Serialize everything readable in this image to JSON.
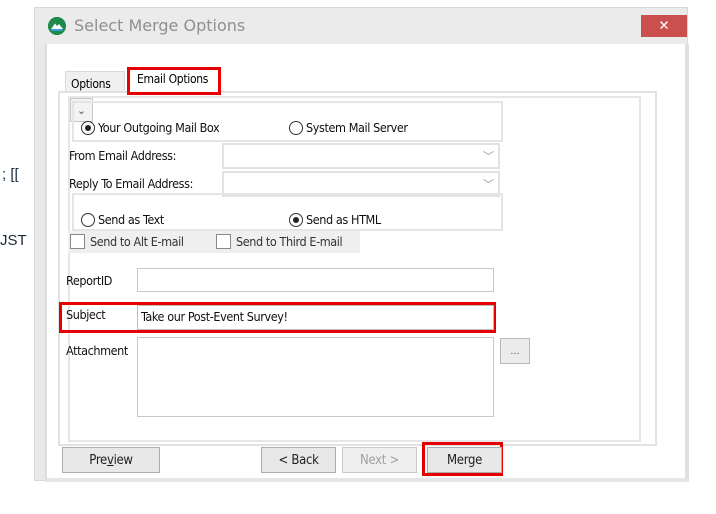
{
  "background": {
    "fragment1": "; [[",
    "fragment2": "JST"
  },
  "window": {
    "title": "Select Merge Options",
    "app_icon": "mountain-logo-icon",
    "close_icon": "close-icon",
    "close_label": "✕"
  },
  "tabs": [
    {
      "label": "Options",
      "active": false
    },
    {
      "label": "Email Options",
      "active": true
    }
  ],
  "email_options": {
    "mail_source": {
      "options": [
        {
          "label": "Your Outgoing Mail Box",
          "selected": true
        },
        {
          "label": "System Mail Server",
          "selected": false
        }
      ]
    },
    "from_email": {
      "label": "From Email Address:",
      "value": ""
    },
    "reply_to_email": {
      "label": "Reply To Email Address:",
      "value": ""
    },
    "send_format": {
      "options": [
        {
          "label": "Send as Text",
          "selected": false
        },
        {
          "label": "Send as HTML",
          "selected": true
        }
      ]
    },
    "checkboxes": [
      {
        "label": "Send to Alt E-mail",
        "checked": false
      },
      {
        "label": "Send to Third E-mail",
        "checked": false
      }
    ],
    "report_id": {
      "label": "ReportID",
      "value": ""
    },
    "subject": {
      "label": "Subject",
      "value": "Take our Post-Event Survey!"
    },
    "attachment": {
      "label": "Attachment",
      "value": "",
      "browse_label": "..."
    }
  },
  "buttons": {
    "preview_pre": "Pre",
    "preview_mnemonic": "v",
    "preview_post": "iew",
    "back": "< Back",
    "next": "Next >",
    "merge": "Merge"
  },
  "highlight_color": "#e60000"
}
